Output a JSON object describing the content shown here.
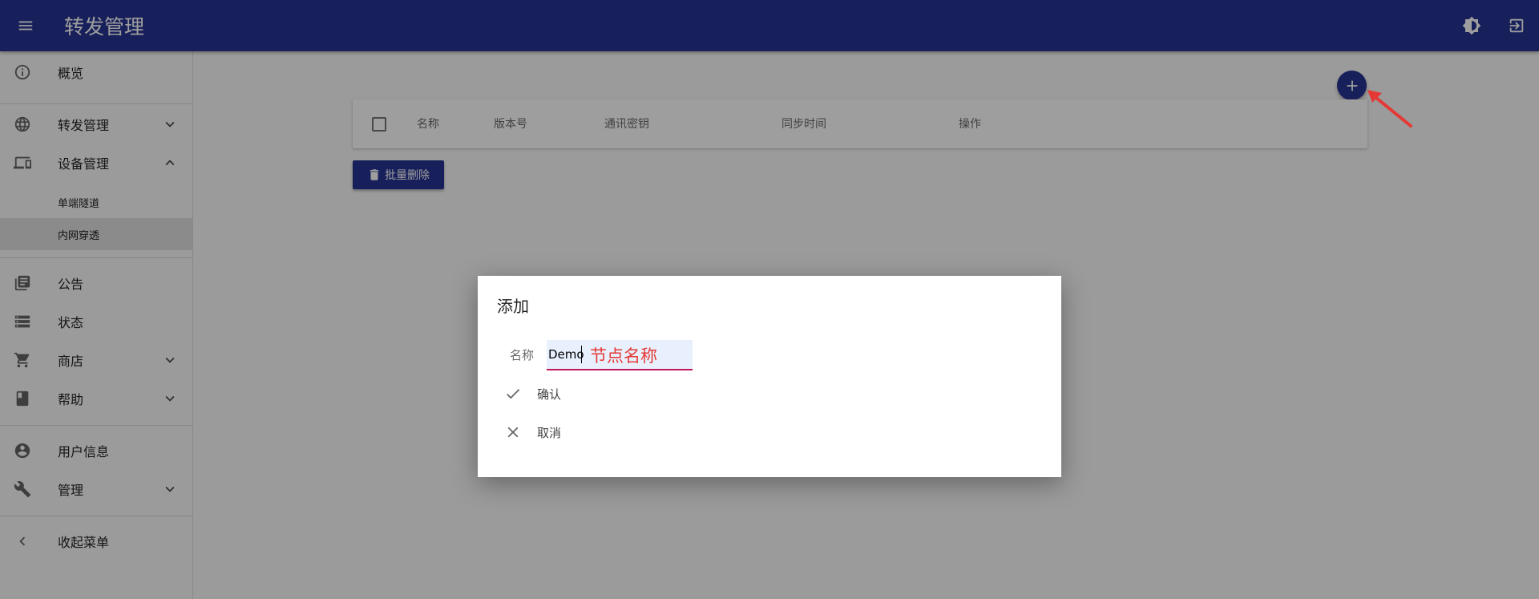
{
  "appbar": {
    "title": "转发管理",
    "menu_icon": "menu-icon",
    "theme_icon": "brightness-icon",
    "logout_icon": "logout-icon",
    "color": "#283593"
  },
  "sidebar": {
    "items": [
      {
        "label": "概览",
        "icon": "info-icon"
      },
      {
        "label": "转发管理",
        "icon": "globe-icon",
        "chevron": "expand-more"
      },
      {
        "label": "设备管理",
        "icon": "devices-icon",
        "chevron": "expand-less"
      },
      {
        "label": "公告",
        "icon": "library-books-icon"
      },
      {
        "label": "状态",
        "icon": "storage-icon"
      },
      {
        "label": "商店",
        "icon": "cart-icon",
        "chevron": "expand-more"
      },
      {
        "label": "帮助",
        "icon": "book-icon",
        "chevron": "expand-more"
      },
      {
        "label": "用户信息",
        "icon": "account-circle-icon"
      },
      {
        "label": "管理",
        "icon": "wrench-icon",
        "chevron": "expand-more"
      },
      {
        "label": "收起菜单",
        "icon": "chevron-left-icon"
      }
    ],
    "subitems": [
      {
        "label": "单端隧道",
        "selected": false
      },
      {
        "label": "内网穿透",
        "selected": true
      }
    ]
  },
  "main": {
    "add_button_icon": "add-icon",
    "table": {
      "headers": [
        "名称",
        "版本号",
        "通讯密钥",
        "同步时间",
        "操作"
      ]
    },
    "batch_delete_label": "批量删除"
  },
  "dialog": {
    "title": "添加",
    "field_label": "名称",
    "field_value": "Demo",
    "annotation": "节点名称",
    "confirm_label": "确认",
    "cancel_label": "取消"
  },
  "colors": {
    "primary": "#283593",
    "annotation_red": "#e53935",
    "field_underline": "#c2185b"
  }
}
